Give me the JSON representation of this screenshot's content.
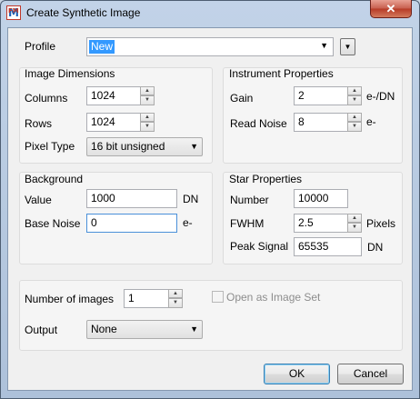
{
  "window": {
    "title": "Create Synthetic Image",
    "icon": "fm-app-icon",
    "close_label": "✕"
  },
  "profile": {
    "label": "Profile",
    "value": "New"
  },
  "image_dimensions": {
    "title": "Image Dimensions",
    "columns_label": "Columns",
    "columns_value": "1024",
    "rows_label": "Rows",
    "rows_value": "1024",
    "pixel_type_label": "Pixel Type",
    "pixel_type_value": "16 bit unsigned"
  },
  "instrument_properties": {
    "title": "Instrument Properties",
    "gain_label": "Gain",
    "gain_value": "2",
    "gain_unit": "e-/DN",
    "read_noise_label": "Read Noise",
    "read_noise_value": "8",
    "read_noise_unit": "e-"
  },
  "background": {
    "title": "Background",
    "value_label": "Value",
    "value_value": "1000",
    "value_unit": "DN",
    "base_noise_label": "Base Noise",
    "base_noise_value": "0",
    "base_noise_unit": "e-"
  },
  "star_properties": {
    "title": "Star Properties",
    "number_label": "Number",
    "number_value": "10000",
    "fwhm_label": "FWHM",
    "fwhm_value": "2.5",
    "fwhm_unit": "Pixels",
    "peak_label": "Peak Signal",
    "peak_value": "65535",
    "peak_unit": "DN"
  },
  "output_section": {
    "num_images_label": "Number of images",
    "num_images_value": "1",
    "open_as_set_label": "Open as Image Set",
    "open_as_set_checked": false,
    "output_label": "Output",
    "output_value": "None"
  },
  "buttons": {
    "ok": "OK",
    "cancel": "Cancel"
  }
}
